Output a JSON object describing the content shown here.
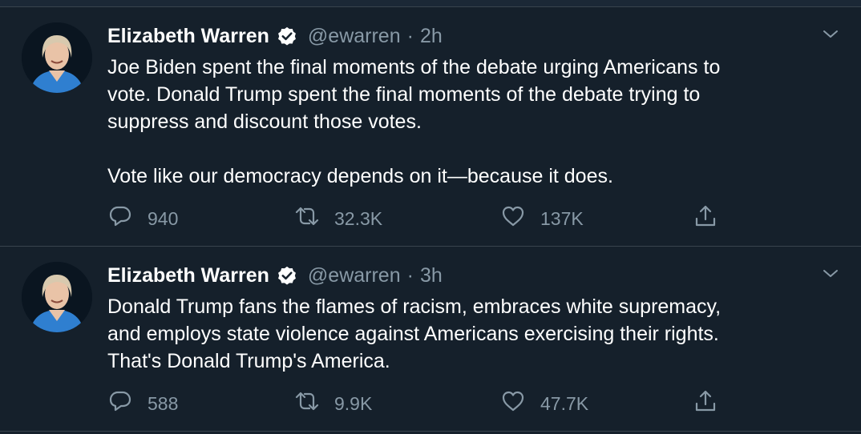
{
  "tweets": [
    {
      "name": "Elizabeth Warren",
      "handle": "@ewarren",
      "separator": "·",
      "time": "2h",
      "text": "Joe Biden spent the final moments of the debate urging Americans to\nvote. Donald Trump spent the final moments of the debate trying to\nsuppress and discount those votes.\n\nVote like our democracy depends on it—because it does.",
      "replies": "940",
      "retweets": "32.3K",
      "likes": "137K"
    },
    {
      "name": "Elizabeth Warren",
      "handle": "@ewarren",
      "separator": "·",
      "time": "3h",
      "text": "Donald Trump fans the flames of racism, embraces white supremacy,\nand employs state violence against Americans exercising their rights.\nThat's Donald Trump's America.",
      "replies": "588",
      "retweets": "9.9K",
      "likes": "47.7K"
    }
  ],
  "colors": {
    "background": "#15202b",
    "secondary_text": "#8899a6",
    "divider": "#38444d",
    "verified": "#ffffff"
  },
  "icons": [
    "chevron-down-icon",
    "verified-badge-icon",
    "reply-icon",
    "retweet-icon",
    "like-icon",
    "share-icon"
  ]
}
